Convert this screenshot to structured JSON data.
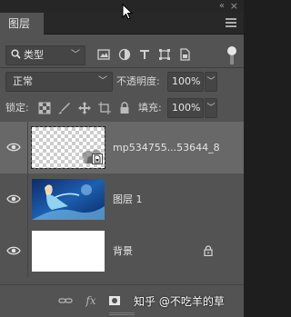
{
  "window": {
    "collapse_glyph": "«",
    "close_glyph": "×"
  },
  "tabs": [
    {
      "label": "图层"
    }
  ],
  "filter": {
    "kind_label": "类型",
    "kind_icon": "search-icon",
    "filter_icons": [
      "pixel-filter-icon",
      "adjustment-filter-icon",
      "type-filter-icon",
      "shape-filter-icon",
      "smart-object-filter-icon"
    ]
  },
  "blend": {
    "mode": "正常",
    "opacity_label": "不透明度:",
    "opacity_value": "100%"
  },
  "lock": {
    "label": "锁定:",
    "fill_label": "填充:",
    "fill_value": "100%"
  },
  "layers": [
    {
      "name": "mp534755...53644_8",
      "visible": true,
      "selected": true,
      "type": "smart-object"
    },
    {
      "name": "图层 1",
      "visible": true,
      "selected": false,
      "type": "pixel"
    },
    {
      "name": "背景",
      "visible": true,
      "selected": false,
      "type": "background",
      "locked": true
    }
  ],
  "footer": {
    "fx_label": "fx",
    "watermark": "知乎 @不吃羊的草"
  },
  "colors": {
    "panel": "#535353",
    "selected_row": "#686868",
    "tab_bg": "#535353"
  }
}
